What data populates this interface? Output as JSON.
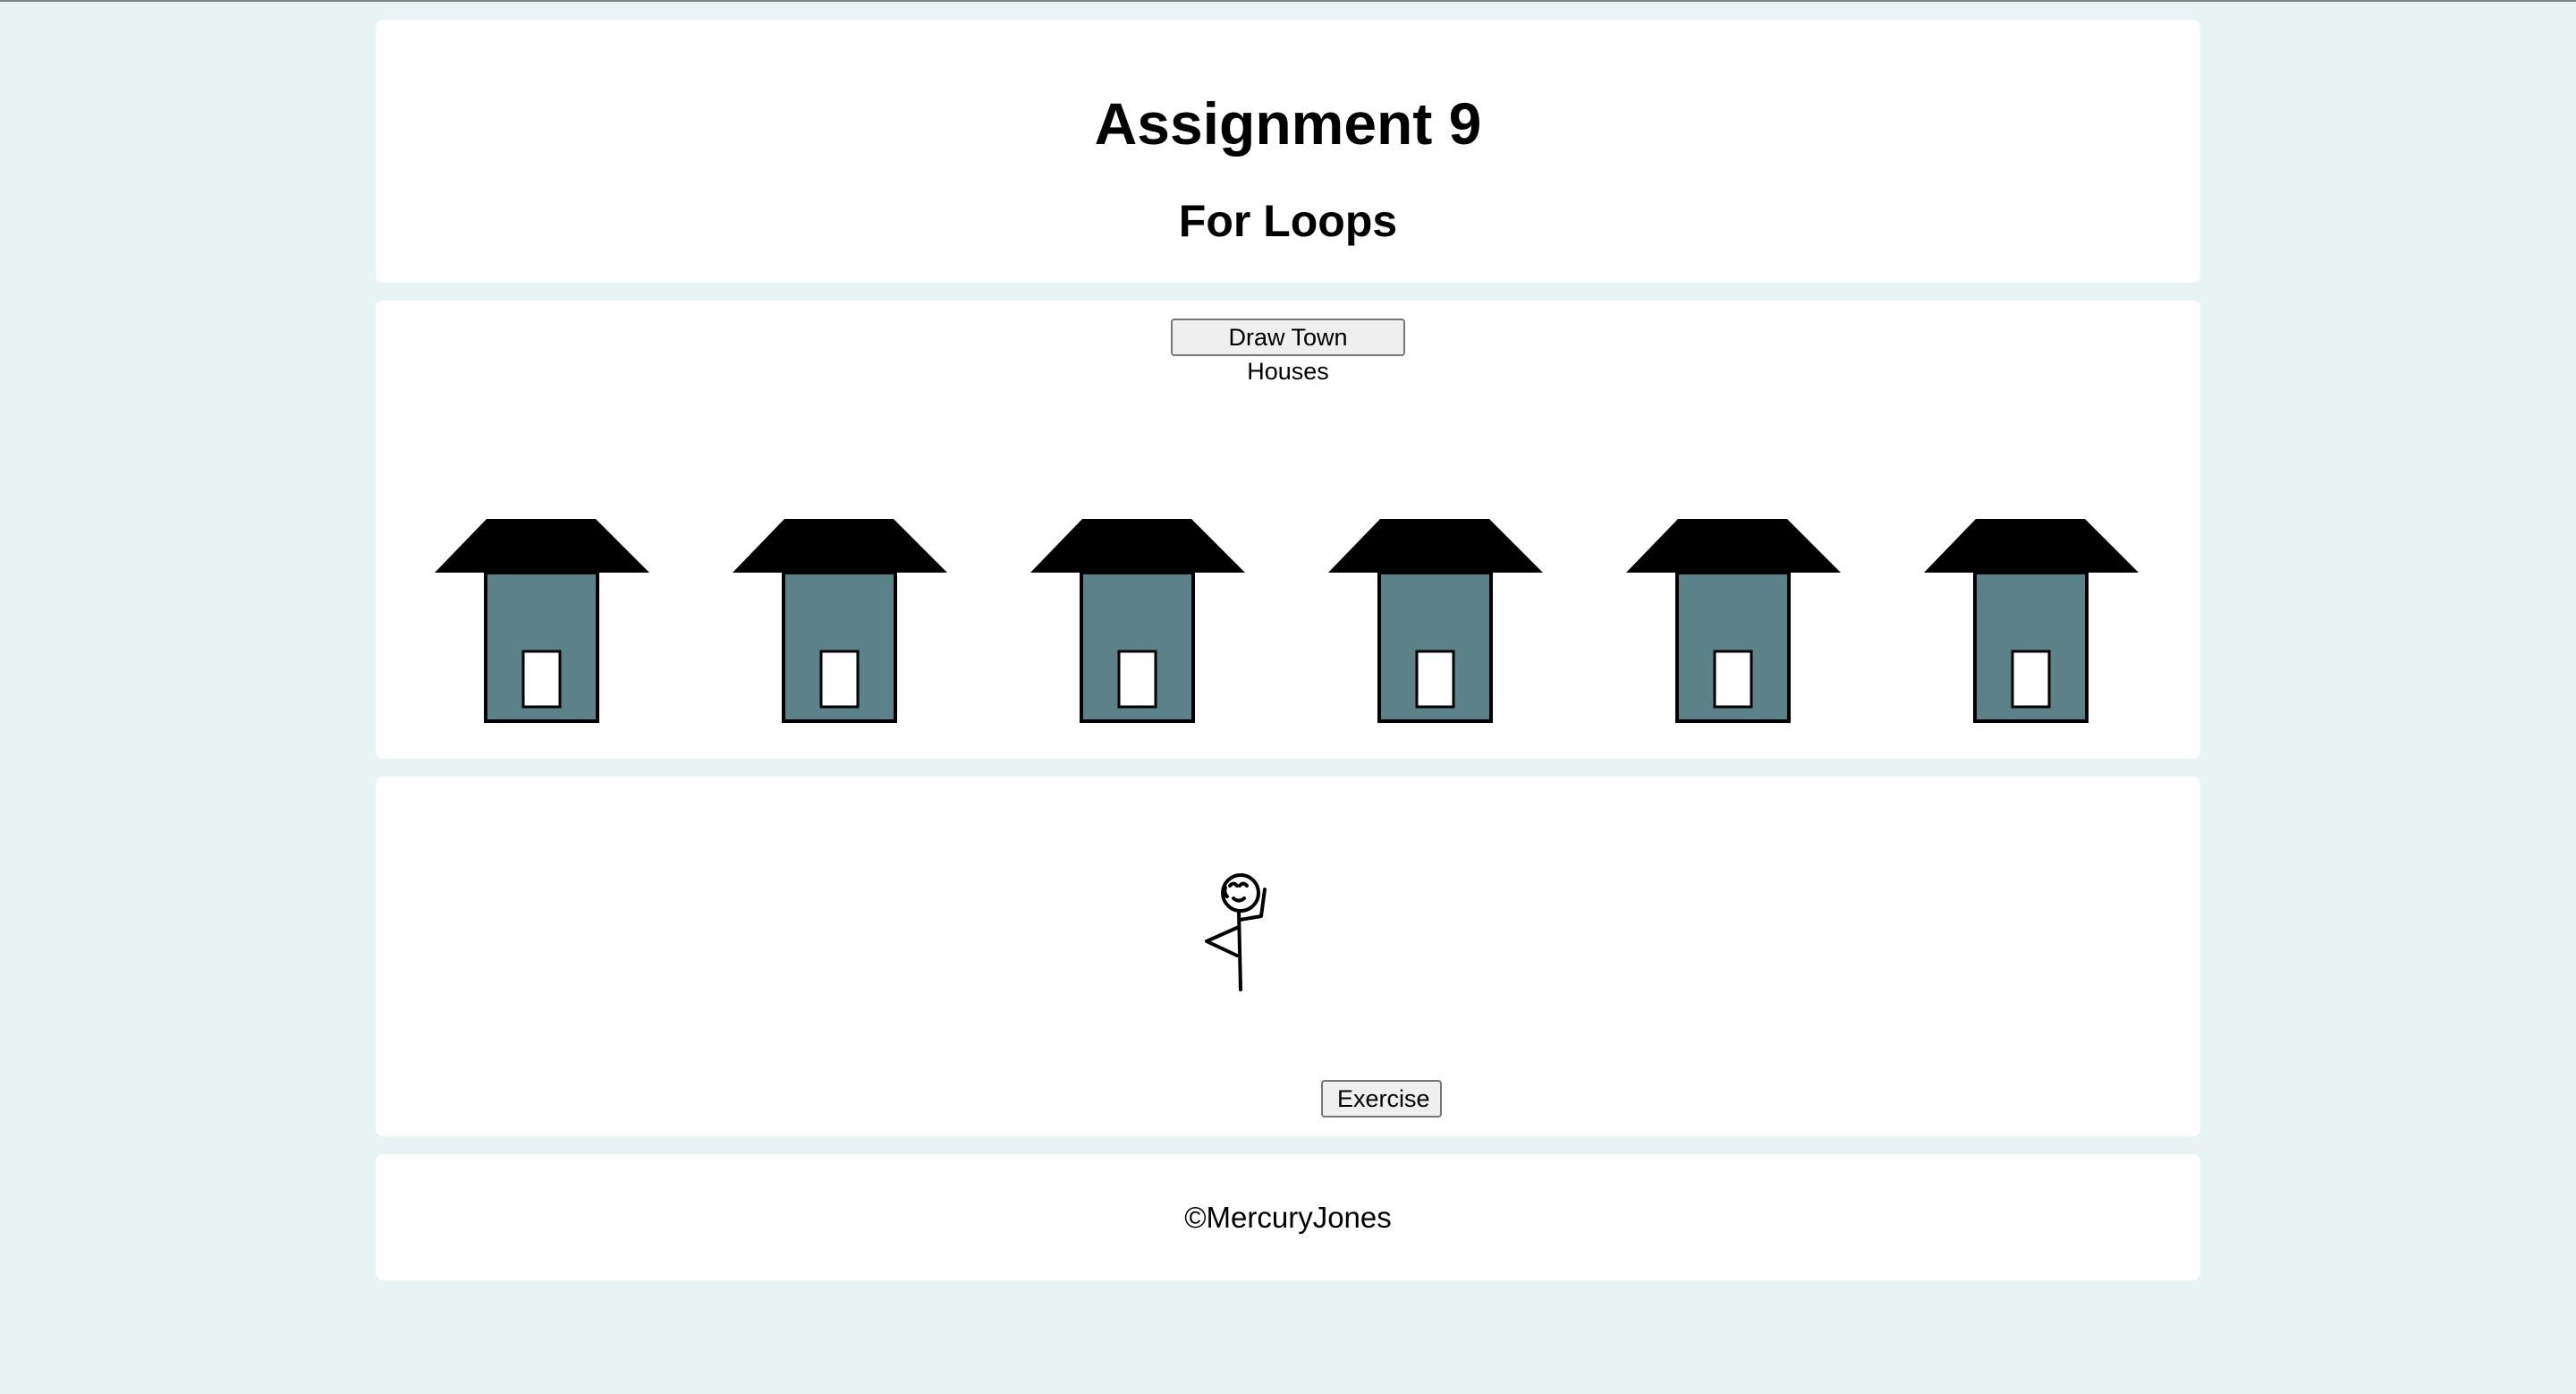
{
  "header": {
    "title": "Assignment 9",
    "subtitle": "For Loops"
  },
  "houses_section": {
    "button_label": "Draw Town Houses",
    "house_count": 6,
    "colors": {
      "roof": "#000000",
      "wall": "#5a8288",
      "door": "#ffffff",
      "outline": "#000000"
    }
  },
  "exercise_section": {
    "button_label": "Exercise",
    "figure_icon": "stick-figure-icon"
  },
  "footer": {
    "text": "©MercuryJones"
  },
  "colors": {
    "background": "#e8f4f4",
    "panel": "#ffffff"
  }
}
